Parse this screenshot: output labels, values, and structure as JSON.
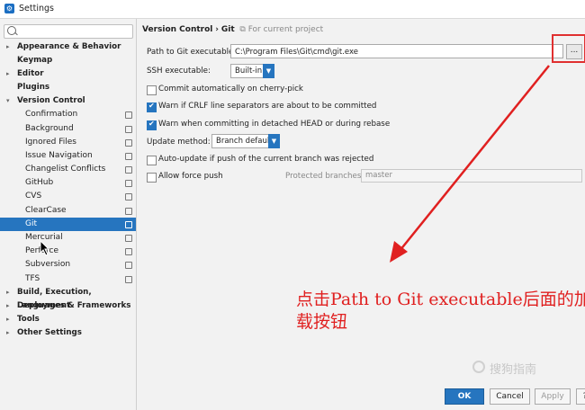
{
  "window": {
    "title": "Settings"
  },
  "sidebar": {
    "search_placeholder": "",
    "items": [
      {
        "label": "Appearance & Behavior",
        "arrow": "▸"
      },
      {
        "label": "Keymap"
      },
      {
        "label": "Editor",
        "arrow": "▸"
      },
      {
        "label": "Plugins"
      },
      {
        "label": "Version Control",
        "arrow": "▾"
      },
      {
        "label": "Confirmation"
      },
      {
        "label": "Background"
      },
      {
        "label": "Ignored Files"
      },
      {
        "label": "Issue Navigation"
      },
      {
        "label": "Changelist Conflicts"
      },
      {
        "label": "GitHub"
      },
      {
        "label": "CVS"
      },
      {
        "label": "ClearCase"
      },
      {
        "label": "Git"
      },
      {
        "label": "Mercurial"
      },
      {
        "label": "Perforce"
      },
      {
        "label": "Subversion"
      },
      {
        "label": "TFS"
      },
      {
        "label": "Build, Execution, Deployment",
        "arrow": "▸"
      },
      {
        "label": "Languages & Frameworks",
        "arrow": "▸"
      },
      {
        "label": "Tools",
        "arrow": "▸"
      },
      {
        "label": "Other Settings",
        "arrow": "▸"
      }
    ]
  },
  "breadcrumb": {
    "section": "Version Control",
    "separator": "›",
    "page": "Git",
    "scope": "For current project"
  },
  "form": {
    "path_label": "Path to Git executable:",
    "path_value": "C:\\Program Files\\Git\\cmd\\git.exe",
    "browse_label": "...",
    "ssh_label": "SSH executable:",
    "ssh_value": "Built-in",
    "cherry_pick_label": "Commit automatically on cherry-pick",
    "crlf_label": "Warn if CRLF line separators are about to be committed",
    "detached_label": "Warn when committing in detached HEAD or during rebase",
    "update_method_label": "Update method:",
    "update_method_value": "Branch default",
    "auto_update_label": "Auto-update if push of the current branch was rejected",
    "force_push_label": "Allow force push",
    "protected_label": "Protected branches:",
    "protected_value": "master"
  },
  "annotation": {
    "text": "点击Path to Git executable后面的加载按钮",
    "color": "#e02020"
  },
  "watermark": {
    "text": "搜狗指南"
  },
  "buttons": {
    "ok": "OK",
    "cancel": "Cancel",
    "apply": "Apply",
    "help": "?"
  },
  "colors": {
    "accent": "#2675bf",
    "highlight": "#e03030"
  }
}
